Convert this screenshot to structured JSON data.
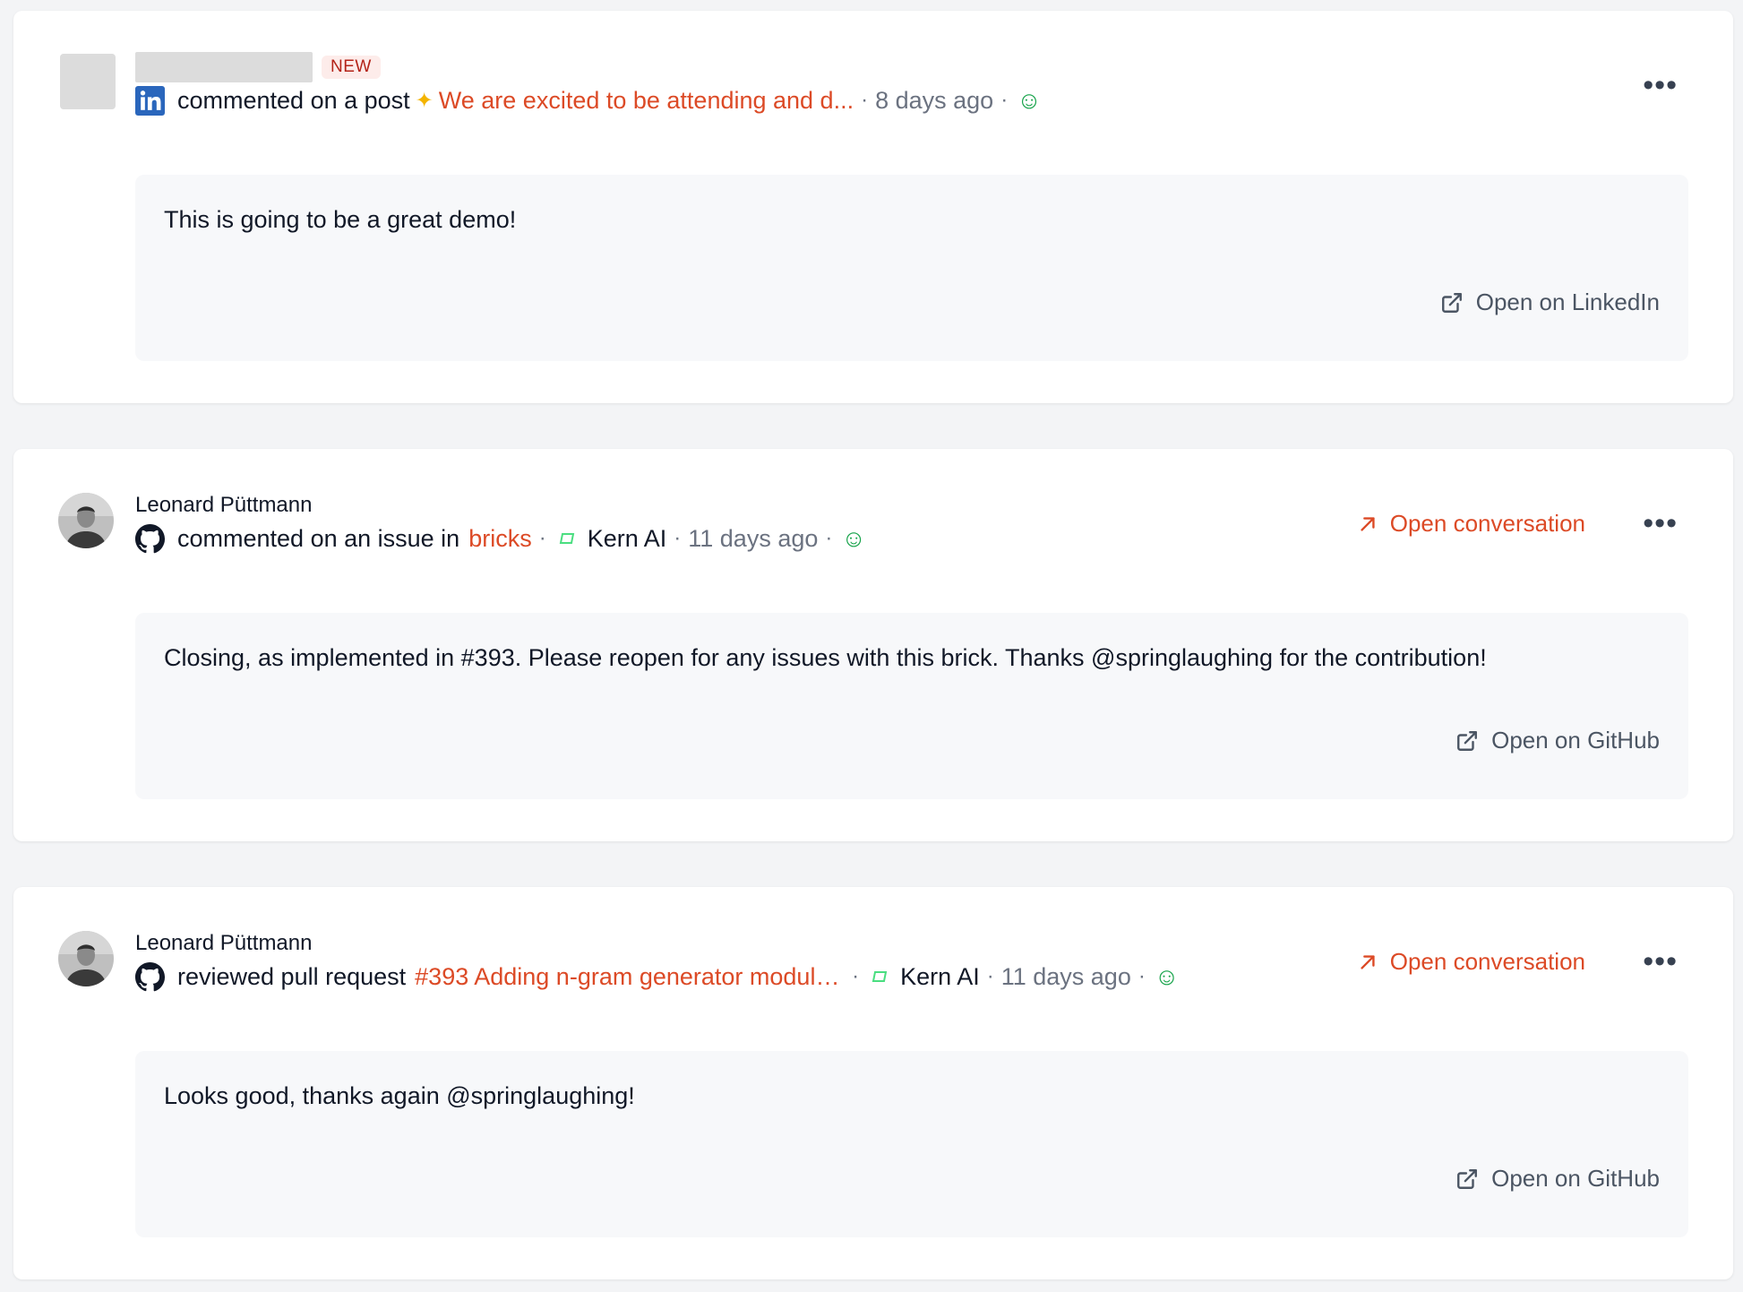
{
  "colors": {
    "accent": "#dc4a26",
    "muted": "#6b7280",
    "smiley": "#16a34a",
    "linkedin": "#2a66bc",
    "card_body_bg": "#f7f8fa"
  },
  "activities": [
    {
      "badge": "NEW",
      "source_icon": "linkedin-icon",
      "action": "commented on a post",
      "target": "We are excited to be attending and d...",
      "time": "8 days ago",
      "reaction_icon": "smiley-icon",
      "text": "This is going to be a great demo!",
      "external_link": "Open on LinkedIn"
    },
    {
      "author": "Leonard Püttmann",
      "source_icon": "github-icon",
      "action": "commented on an issue in",
      "target": "bricks",
      "org": "Kern AI",
      "time": "11 days ago",
      "reaction_icon": "smiley-icon",
      "open_conversation": "Open conversation",
      "text": "Closing, as implemented in #393.  Please reopen for any issues with this brick. Thanks @springlaughing for the contribution!",
      "external_link": "Open on GitHub"
    },
    {
      "author": "Leonard Püttmann",
      "source_icon": "github-icon",
      "action": "reviewed pull request",
      "target": "#393 Adding n-gram generator module ...",
      "org": "Kern AI",
      "time": "11 days ago",
      "reaction_icon": "smiley-icon",
      "open_conversation": "Open conversation",
      "text": "Looks good, thanks again @springlaughing!",
      "external_link": "Open on GitHub"
    }
  ]
}
